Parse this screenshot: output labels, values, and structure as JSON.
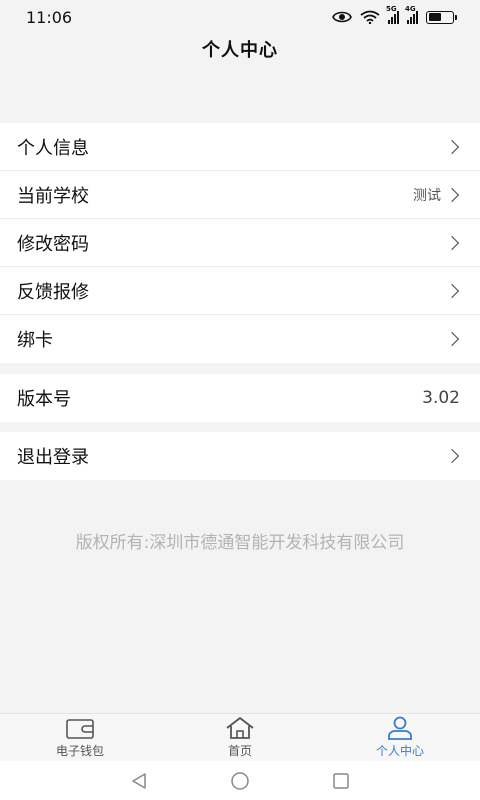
{
  "status_bar": {
    "time": "11:06",
    "net1": "5G",
    "net2": "4G",
    "battery_level": 0.55
  },
  "page": {
    "title": "个人中心"
  },
  "menu": {
    "personal_info": "个人信息",
    "current_school": "当前学校",
    "current_school_value": "测试",
    "change_password": "修改密码",
    "feedback_repair": "反馈报修",
    "bind_card": "绑卡"
  },
  "version": {
    "label": "版本号",
    "value": "3.02"
  },
  "logout": {
    "label": "退出登录"
  },
  "footer": {
    "copyright": "版权所有:深圳市德通智能开发科技有限公司"
  },
  "tabbar": {
    "wallet": "电子钱包",
    "home": "首页",
    "profile": "个人中心",
    "active_color": "#3a7bd5"
  },
  "icons": [
    "eye-icon",
    "wifi-icon",
    "signal-icon",
    "battery-icon",
    "chevron-right-icon",
    "wallet-icon",
    "home-icon",
    "person-icon",
    "back-icon",
    "home-circle-icon",
    "recents-icon"
  ]
}
